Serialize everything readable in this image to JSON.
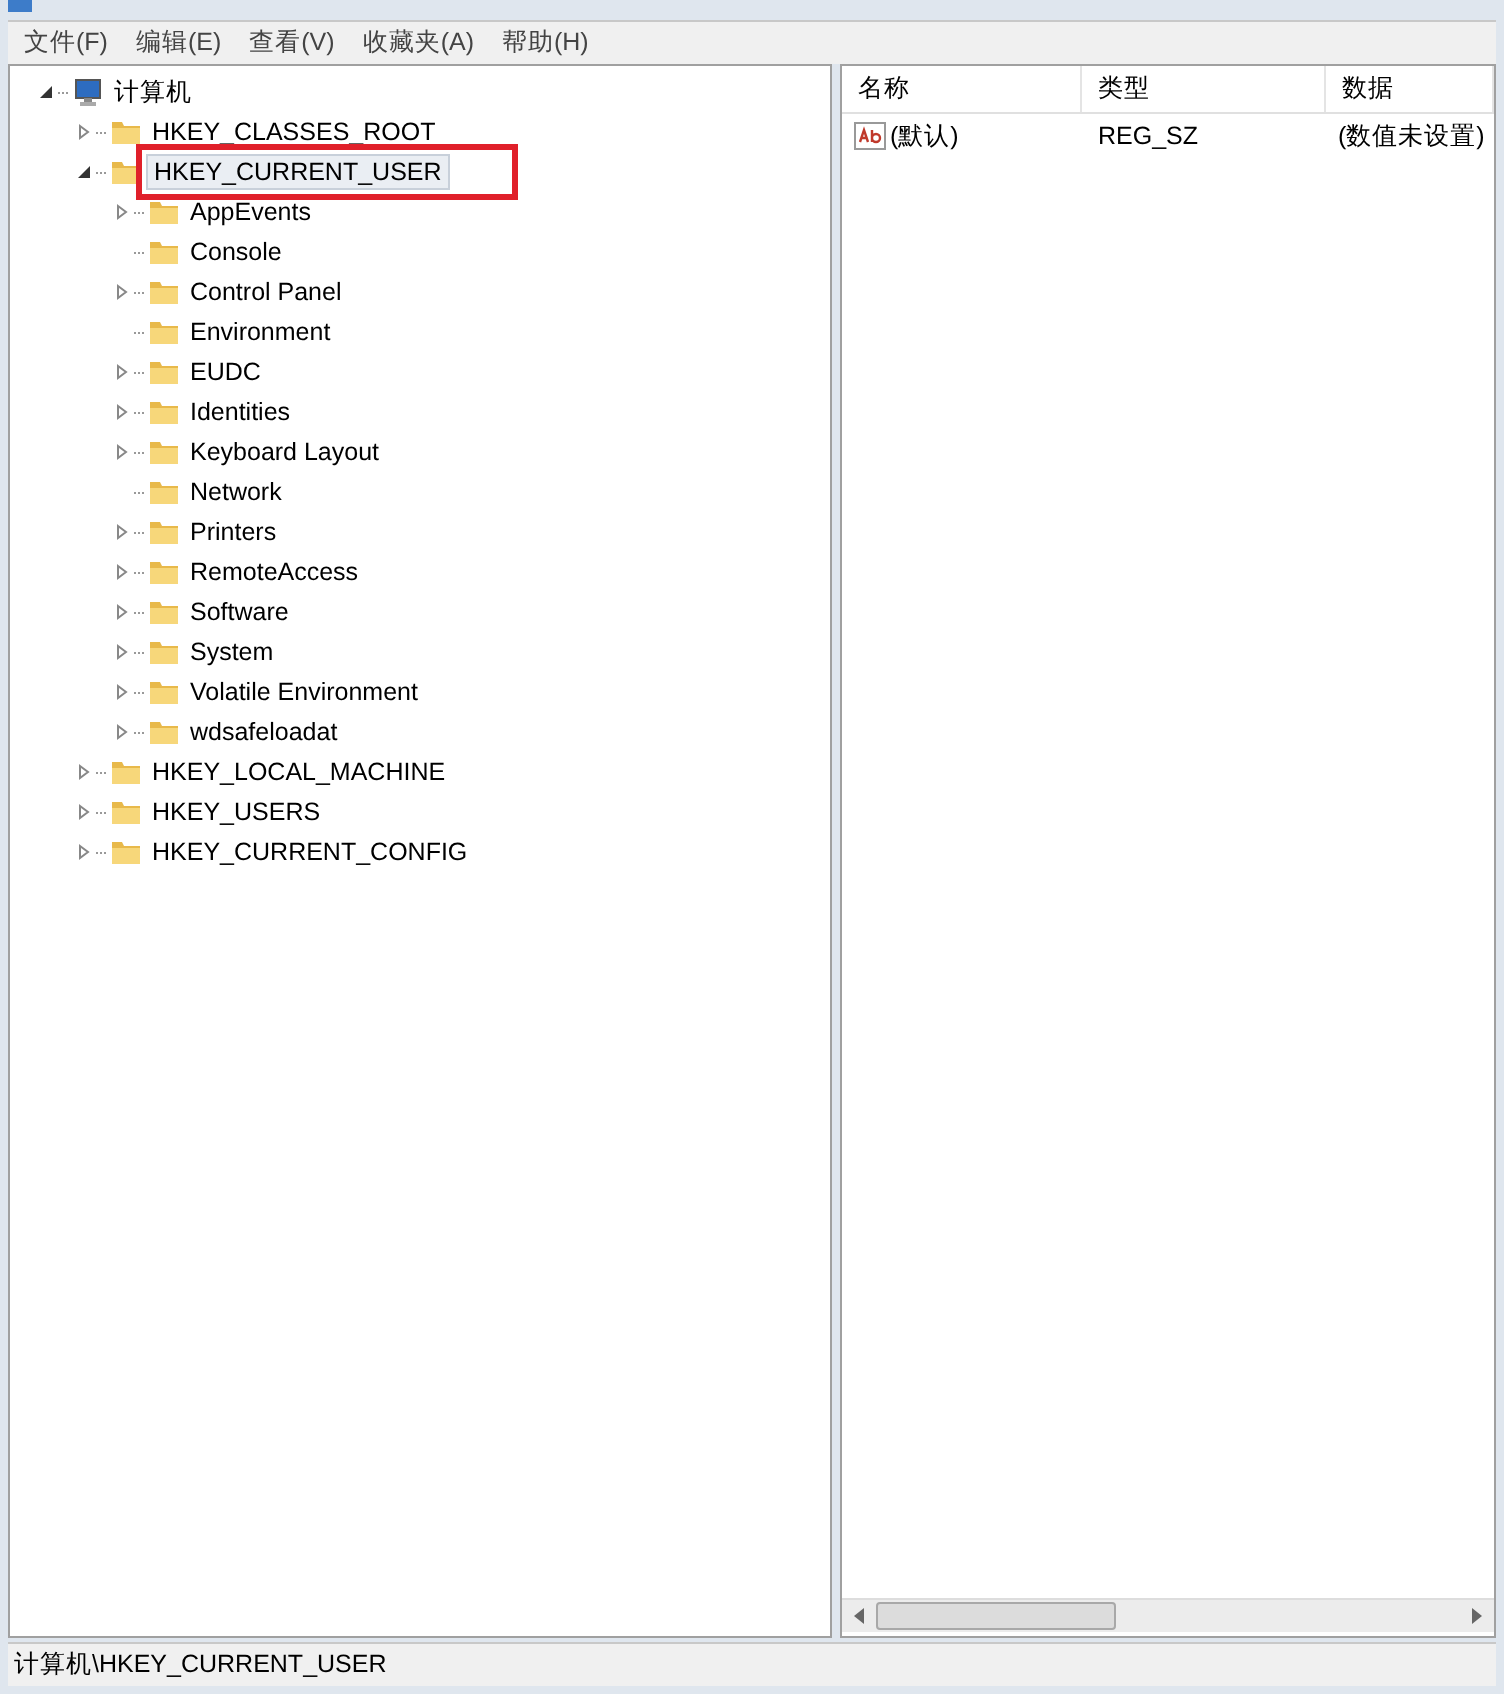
{
  "menu": [
    "文件(F)",
    "编辑(E)",
    "查看(V)",
    "收藏夹(A)",
    "帮助(H)"
  ],
  "tree": [
    {
      "label": "计算机",
      "kind": "computer",
      "has_children": true,
      "expanded": true,
      "selected": false,
      "children": [
        {
          "label": "HKEY_CLASSES_ROOT",
          "kind": "folder",
          "has_children": true,
          "expanded": false,
          "selected": false
        },
        {
          "label": "HKEY_CURRENT_USER",
          "kind": "folder",
          "has_children": true,
          "expanded": true,
          "selected": true,
          "annotated": true,
          "children": [
            {
              "label": "AppEvents",
              "kind": "folder",
              "has_children": true,
              "expanded": false,
              "selected": false
            },
            {
              "label": "Console",
              "kind": "folder",
              "has_children": false,
              "selected": false
            },
            {
              "label": "Control Panel",
              "kind": "folder",
              "has_children": true,
              "expanded": false,
              "selected": false
            },
            {
              "label": "Environment",
              "kind": "folder",
              "has_children": false,
              "selected": false
            },
            {
              "label": "EUDC",
              "kind": "folder",
              "has_children": true,
              "expanded": false,
              "selected": false
            },
            {
              "label": "Identities",
              "kind": "folder",
              "has_children": true,
              "expanded": false,
              "selected": false
            },
            {
              "label": "Keyboard Layout",
              "kind": "folder",
              "has_children": true,
              "expanded": false,
              "selected": false
            },
            {
              "label": "Network",
              "kind": "folder",
              "has_children": false,
              "selected": false
            },
            {
              "label": "Printers",
              "kind": "folder",
              "has_children": true,
              "expanded": false,
              "selected": false
            },
            {
              "label": "RemoteAccess",
              "kind": "folder",
              "has_children": true,
              "expanded": false,
              "selected": false
            },
            {
              "label": "Software",
              "kind": "folder",
              "has_children": true,
              "expanded": false,
              "selected": false
            },
            {
              "label": "System",
              "kind": "folder",
              "has_children": true,
              "expanded": false,
              "selected": false
            },
            {
              "label": "Volatile Environment",
              "kind": "folder",
              "has_children": true,
              "expanded": false,
              "selected": false
            },
            {
              "label": "wdsafeloadat",
              "kind": "folder",
              "has_children": true,
              "expanded": false,
              "selected": false
            }
          ]
        },
        {
          "label": "HKEY_LOCAL_MACHINE",
          "kind": "folder",
          "has_children": true,
          "expanded": false,
          "selected": false
        },
        {
          "label": "HKEY_USERS",
          "kind": "folder",
          "has_children": true,
          "expanded": false,
          "selected": false
        },
        {
          "label": "HKEY_CURRENT_CONFIG",
          "kind": "folder",
          "has_children": true,
          "expanded": false,
          "selected": false
        }
      ]
    }
  ],
  "table": {
    "columns": [
      "名称",
      "类型",
      "数据"
    ],
    "rows": [
      {
        "name": "(默认)",
        "type": "REG_SZ",
        "data": "(数值未设置)"
      }
    ]
  },
  "status_bar": "计算机\\HKEY_CURRENT_USER"
}
